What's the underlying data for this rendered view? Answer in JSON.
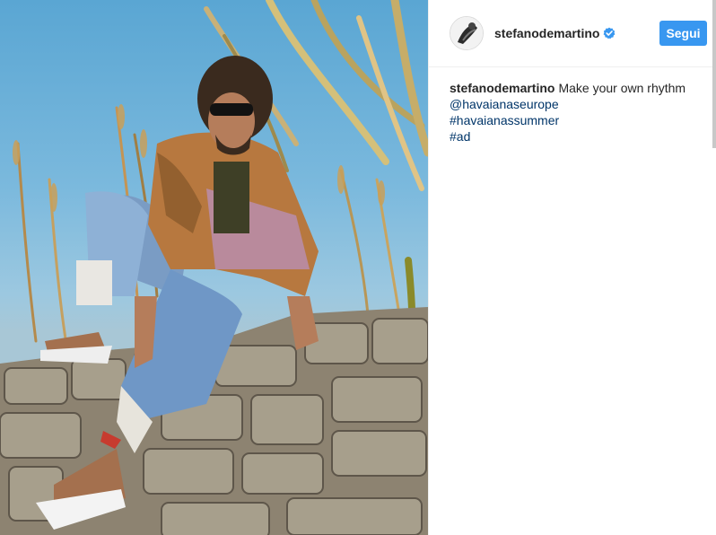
{
  "post": {
    "username": "stefanodemartino",
    "verified_icon": "verified-badge-icon",
    "follow_label": "Segui",
    "caption": {
      "username": "stefanodemartino",
      "text": "Make your own rhythm",
      "mention": "@havaianaseurope",
      "hashtags": [
        "#havaianassummer",
        "#ad"
      ]
    },
    "colors": {
      "accent": "#3897f0",
      "link": "#003569",
      "text": "#262626",
      "divider": "#efefef"
    }
  }
}
